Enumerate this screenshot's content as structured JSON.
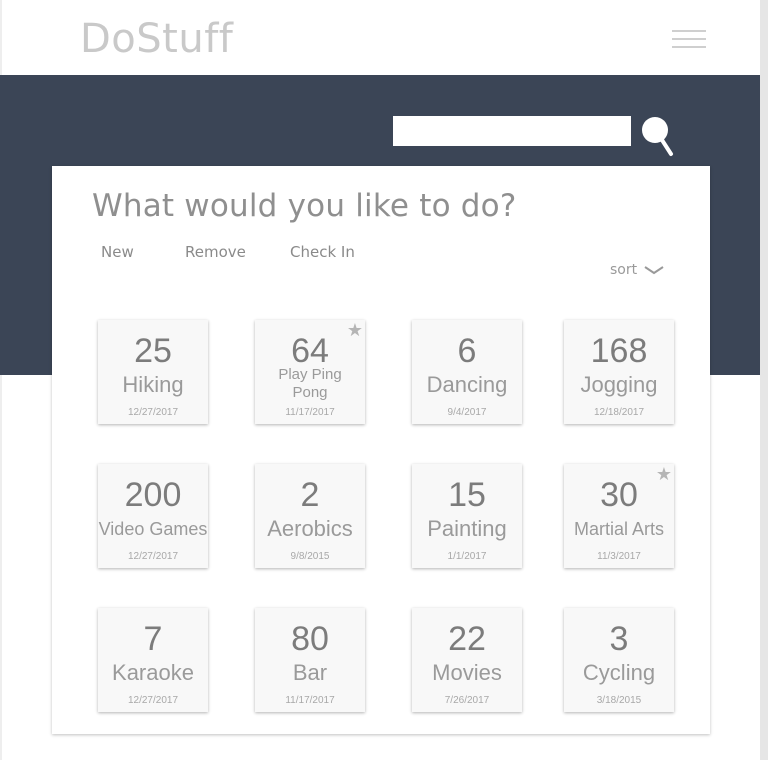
{
  "app": {
    "title": "DoStuff"
  },
  "search": {
    "placeholder": "",
    "value": ""
  },
  "main": {
    "question": "What would you like to do?",
    "actions": [
      "New",
      "Remove",
      "Check In"
    ],
    "sort_label": "sort"
  },
  "activities": [
    {
      "count": "25",
      "name": "Hiking",
      "date": "12/27/2017",
      "starred": false
    },
    {
      "count": "64",
      "name": "Play Ping Pong",
      "date": "11/17/2017",
      "starred": true
    },
    {
      "count": "6",
      "name": "Dancing",
      "date": "9/4/2017",
      "starred": false
    },
    {
      "count": "168",
      "name": "Jogging",
      "date": "12/18/2017",
      "starred": false
    },
    {
      "count": "200",
      "name": "Video Games",
      "date": "12/27/2017",
      "starred": false
    },
    {
      "count": "2",
      "name": "Aerobics",
      "date": "9/8/2015",
      "starred": false
    },
    {
      "count": "15",
      "name": "Painting",
      "date": "1/1/2017",
      "starred": false
    },
    {
      "count": "30",
      "name": "Martial Arts",
      "date": "11/3/2017",
      "starred": true
    },
    {
      "count": "7",
      "name": "Karaoke",
      "date": "12/27/2017",
      "starred": false
    },
    {
      "count": "80",
      "name": "Bar",
      "date": "11/17/2017",
      "starred": false
    },
    {
      "count": "22",
      "name": "Movies",
      "date": "7/26/2017",
      "starred": false
    },
    {
      "count": "3",
      "name": "Cycling",
      "date": "3/18/2015",
      "starred": false
    }
  ],
  "icons": {
    "menu": "hamburger-menu-icon",
    "search": "search-icon",
    "star": "star-icon",
    "sort": "chevron-down-icon"
  },
  "colors": {
    "header_band": "#3b4556",
    "text_muted": "#8f8f8f",
    "card_bg": "#f8f8f8"
  }
}
